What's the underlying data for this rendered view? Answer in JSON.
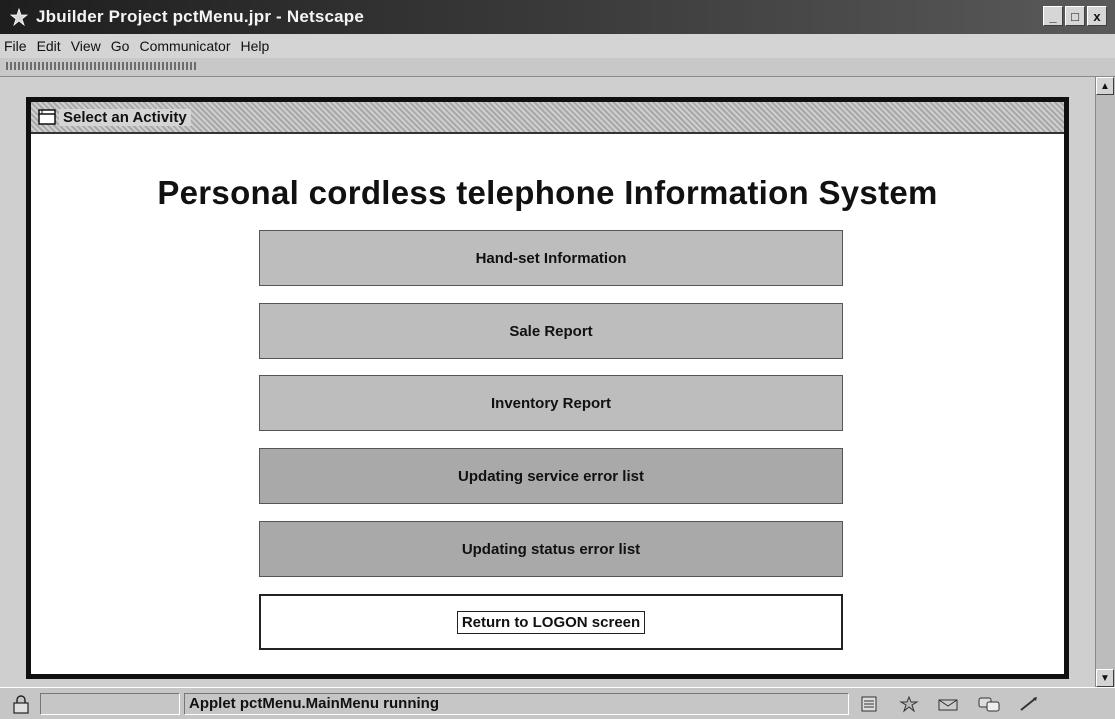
{
  "window": {
    "title": "Jbuilder Project pctMenu.jpr - Netscape",
    "controls": {
      "minimize": "_",
      "maximize": "□",
      "close": "x"
    }
  },
  "menubar": {
    "items": [
      "File",
      "Edit",
      "View",
      "Go",
      "Communicator",
      "Help"
    ]
  },
  "applet": {
    "title": "Select an Activity",
    "heading": "Personal cordless telephone Information System",
    "buttons": [
      "Hand-set Information",
      "Sale Report",
      "Inventory Report",
      "Updating service error list",
      "Updating status error list",
      "Return to LOGON screen"
    ]
  },
  "statusbar": {
    "text": "Applet pctMenu.MainMenu running"
  },
  "icons": {
    "app": "netscape-icon",
    "applet": "window-icon",
    "security": "lock-icon",
    "tray": [
      "component-bar-icon",
      "navigator-icon",
      "mail-icon",
      "discussion-icon",
      "composer-icon"
    ]
  }
}
